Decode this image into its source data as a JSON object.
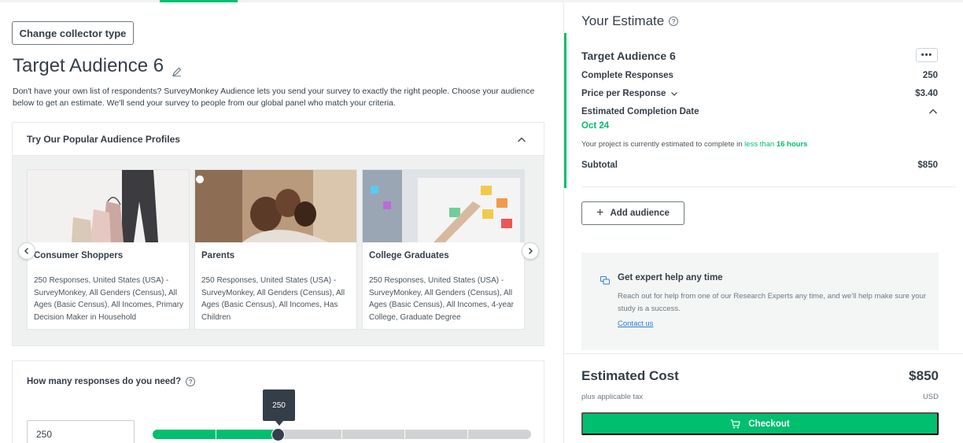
{
  "left": {
    "change_collector_label": "Change collector type",
    "title": "Target Audience 6",
    "description": "Don't have your own list of respondents? SurveyMonkey Audience lets you send your survey to exactly the right people. Choose your audience below to get an estimate. We'll send your survey to people from our global panel who match your criteria.",
    "profiles": {
      "header": "Try Our Popular Audience Profiles",
      "cards": [
        {
          "name": "Consumer Shoppers",
          "desc": "250 Responses, United States (USA) - SurveyMonkey, All Genders (Census), All Ages (Basic Census), All Incomes, Primary Decision Maker in Household"
        },
        {
          "name": "Parents",
          "desc": "250 Responses, United States (USA) - SurveyMonkey, All Genders (Census), All Ages (Basic Census), All Incomes, Has Children"
        },
        {
          "name": "College Graduates",
          "desc": "250 Responses, United States (USA) - SurveyMonkey, All Genders (Census), All Ages (Basic Census), All Incomes, 4-year College, Graduate Degree"
        }
      ]
    },
    "responses": {
      "question": "How many responses do you need?",
      "value": "250",
      "slider_tooltip": "250",
      "slider_fraction": 0.333
    }
  },
  "right": {
    "heading": "Your Estimate",
    "audience_name": "Target Audience 6",
    "more_label": "•••",
    "complete_responses_label": "Complete Responses",
    "complete_responses_value": "250",
    "price_label": "Price per Response",
    "price_value": "$3.40",
    "completion_label": "Estimated Completion Date",
    "completion_date": "Oct 24",
    "note_prefix": "Your project is currently estimated to complete in ",
    "note_less": "less than",
    "note_hours": "16 hours",
    "subtotal_label": "Subtotal",
    "subtotal_value": "$850",
    "add_audience_label": "Add audience",
    "help": {
      "title": "Get expert help any time",
      "desc": "Reach out for help from one of our Research Experts any time, and we'll help make sure your study is a success.",
      "link": "Contact us"
    },
    "cost_label": "Estimated Cost",
    "cost_value": "$850",
    "tax_label": "plus applicable tax",
    "currency": "USD",
    "checkout_label": "Checkout"
  },
  "colors": {
    "accent": "#00bf6f",
    "text": "#333e48",
    "link": "#2d7dd2"
  }
}
